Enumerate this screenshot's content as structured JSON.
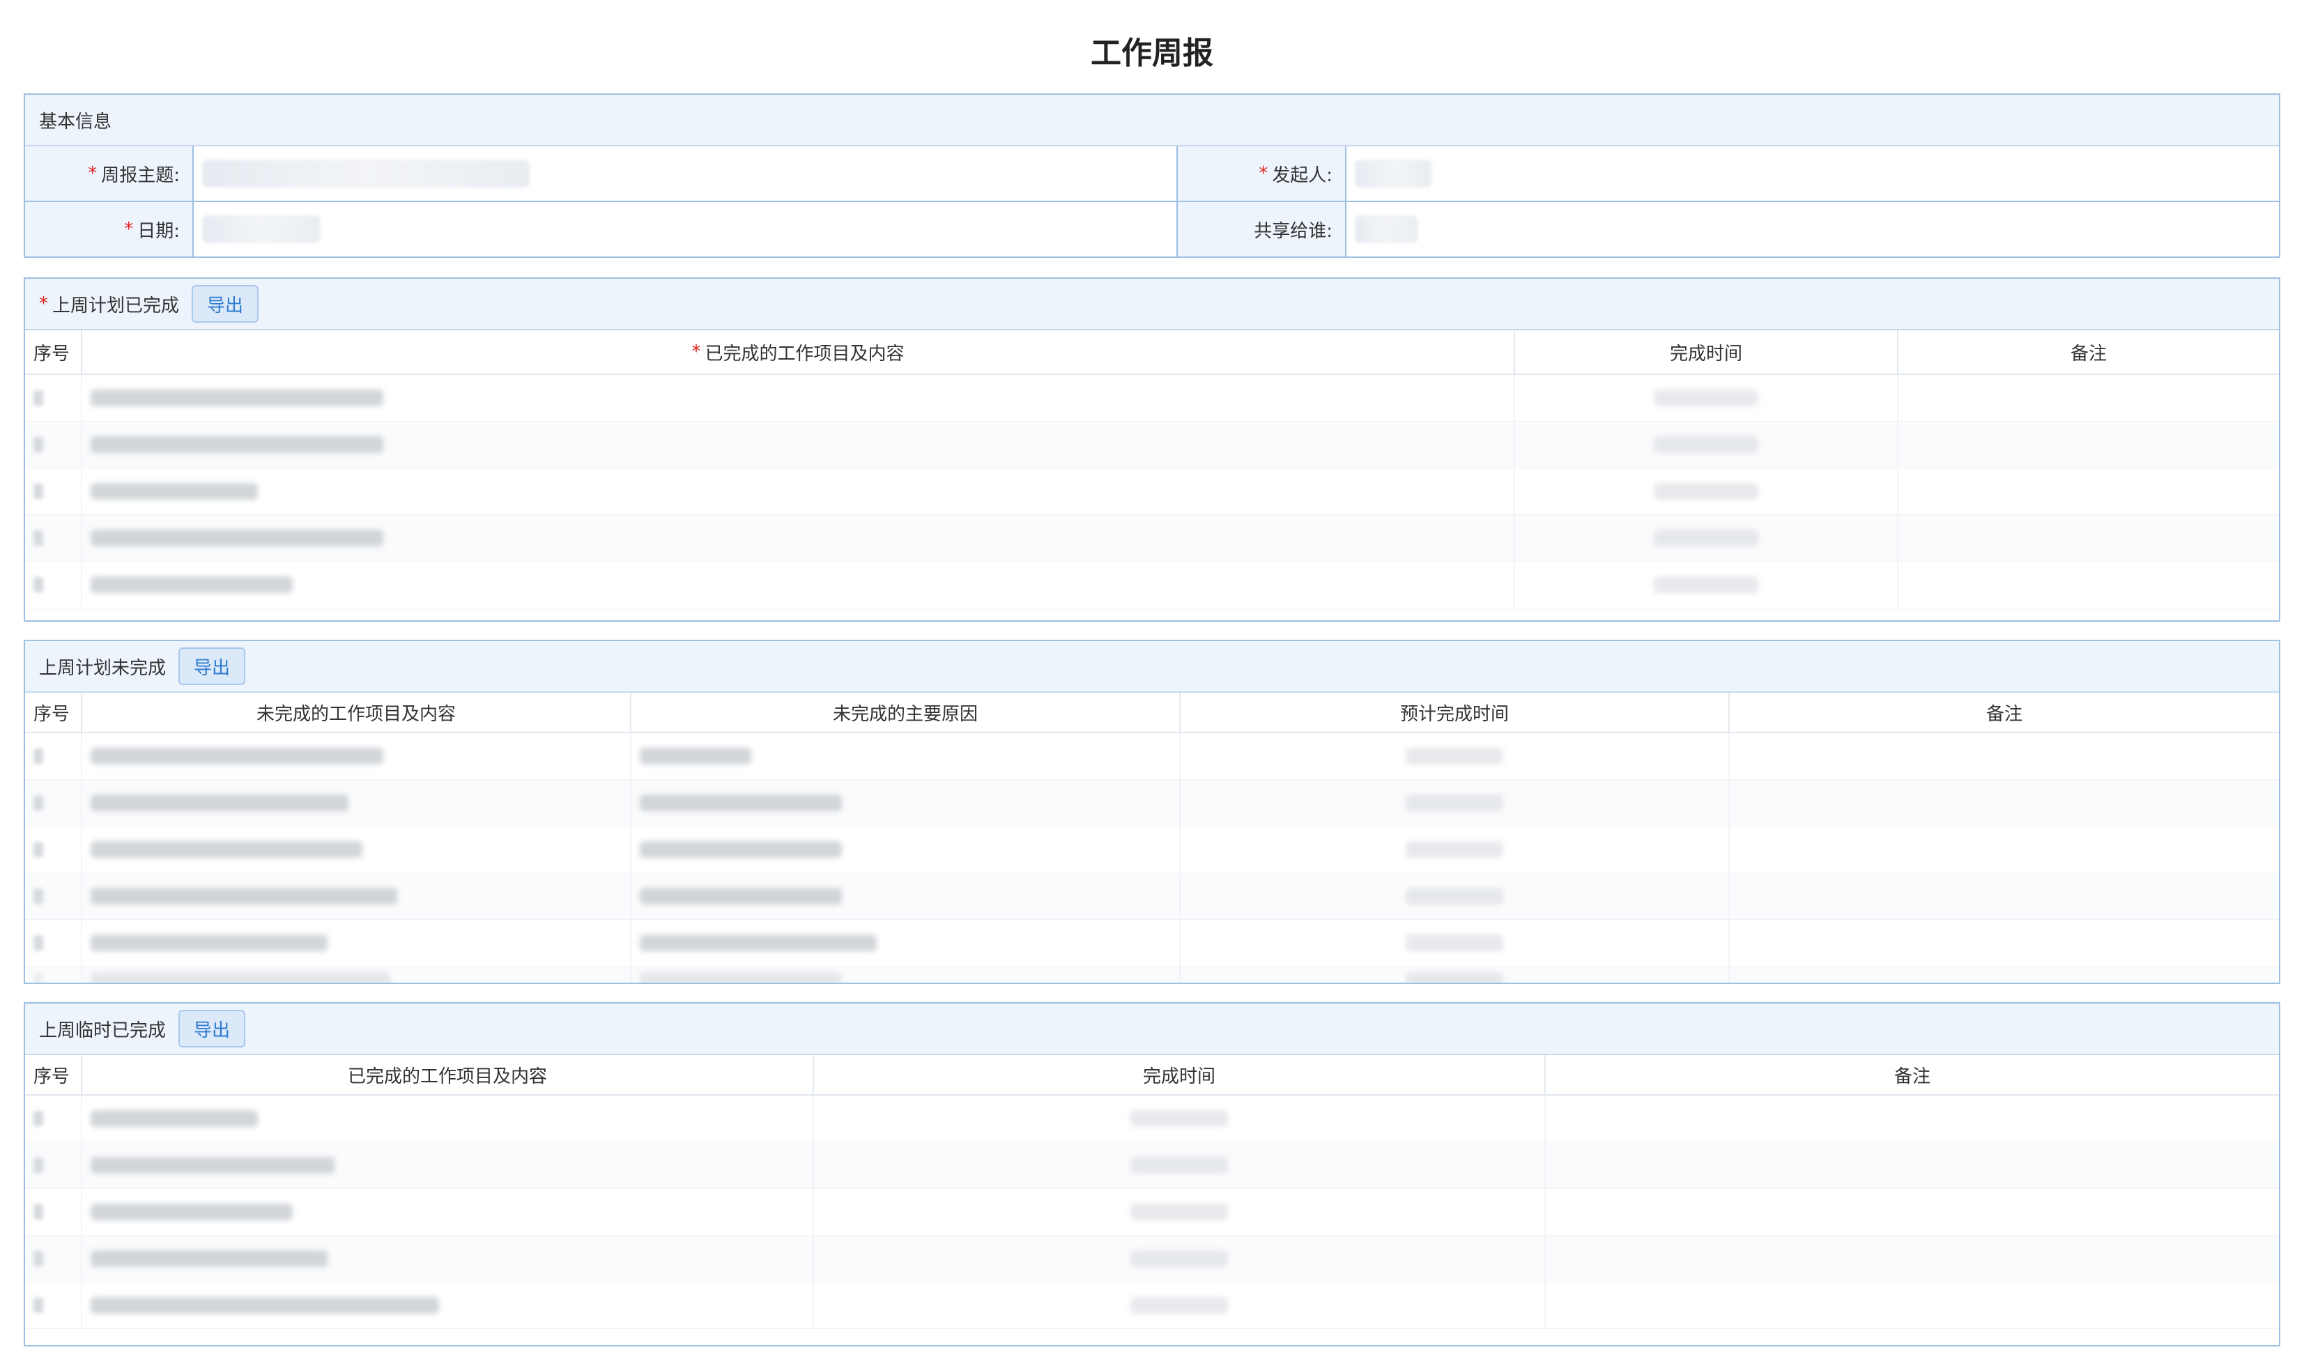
{
  "page": {
    "title": "工作周报"
  },
  "basic_info": {
    "header": "基本信息",
    "fields": [
      {
        "label": "周报主题:",
        "required": true
      },
      {
        "label": "发起人:",
        "required": true
      },
      {
        "label": "日期:",
        "required": true
      },
      {
        "label": "共享给谁:",
        "required": false
      }
    ]
  },
  "planned_done": {
    "header": "上周计划已完成",
    "export_label": "导出",
    "columns": [
      "序号",
      "已完成的工作项目及内容",
      "完成时间",
      "备注"
    ]
  },
  "planned_undone": {
    "header": "上周计划未完成",
    "export_label": "导出",
    "columns": [
      "序号",
      "未完成的工作项目及内容",
      "未完成的主要原因",
      "预计完成时间",
      "备注"
    ]
  },
  "temp_done": {
    "header": "上周临时已完成",
    "export_label": "导出",
    "columns": [
      "序号",
      "已完成的工作项目及内容",
      "完成时间",
      "备注"
    ]
  },
  "colors": {
    "panel_border": "#9cc0e3",
    "header_bg": "#eef4fc",
    "required": "#e02020",
    "button_text": "#2e7ad1"
  }
}
